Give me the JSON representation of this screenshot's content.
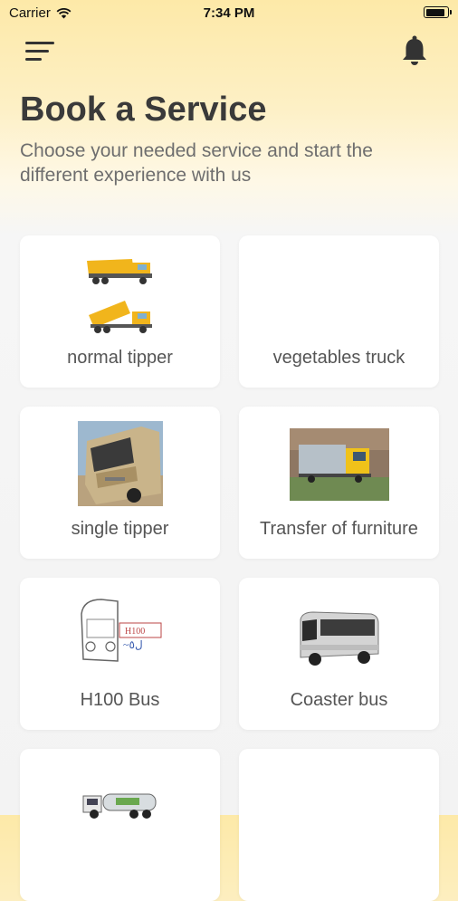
{
  "status": {
    "carrier": "Carrier",
    "time": "7:34 PM"
  },
  "header": {
    "menu_icon": "menu-icon",
    "bell_icon": "bell-icon",
    "title": "Book a Service",
    "subtitle": "Choose your needed service and start the different experience with us"
  },
  "services": [
    {
      "label": "normal tipper"
    },
    {
      "label": "vegetables truck"
    },
    {
      "label": "single tipper"
    },
    {
      "label": "Transfer of furniture"
    },
    {
      "label": "H100 Bus"
    },
    {
      "label": "Coaster bus"
    }
  ],
  "colors": {
    "accent": "#fde9a8",
    "card": "#ffffff",
    "text": "#3a3a3a"
  }
}
